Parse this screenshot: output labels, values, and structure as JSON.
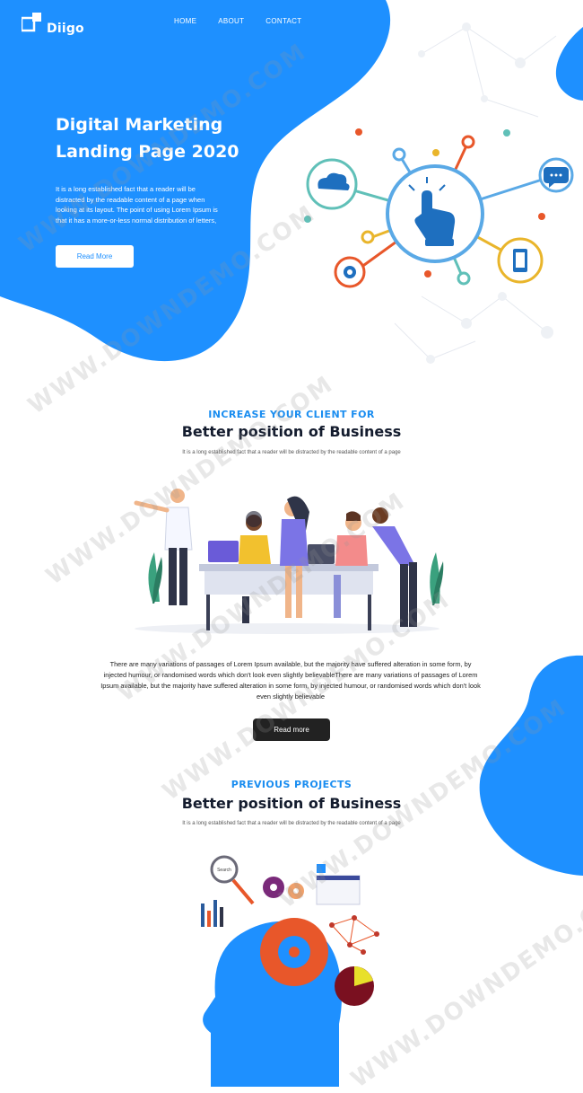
{
  "brand": {
    "name": "Diigo"
  },
  "nav": {
    "items": [
      "HOME",
      "ABOUT",
      "CONTACT"
    ]
  },
  "hero": {
    "title_line1": "Digital Marketing",
    "title_line2": "Landing Page 2020",
    "description": "It is a long established fact that a reader will be distracted by the readable content of a page when looking at its layout. The point of using Lorem Ipsum is that it has a more-or-less normal distribution of letters,",
    "button_label": "Read More"
  },
  "section1": {
    "eyebrow": "INCREASE YOUR CLIENT FOR",
    "title": "Better position of Business",
    "subtitle": "It is a long established fact that a reader will be distracted by the readable content of a page",
    "body": "There are many variations of passages of Lorem Ipsum available, but the majority have suffered alteration in some form, by injected humour, or randomised words which don't look even slightly believableThere are many variations of passages of Lorem Ipsum available, but the majority have suffered alteration in some form, by injected humour, or randomised words which don't look even slightly believable",
    "button_label": "Read more"
  },
  "section2": {
    "eyebrow": "PREVIOUS PROJECTS",
    "title": "Better position of Business",
    "subtitle": "It is a long established fact that a reader will be distracted by the readable content of a page"
  },
  "illustration": {
    "search_label": "Search"
  },
  "watermark": "WWW.DOWNDEMO.COM",
  "colors": {
    "primary": "#1a8df0",
    "dark": "#222222",
    "white": "#ffffff",
    "accent_orange": "#e8572a",
    "accent_yellow": "#f2c12e"
  }
}
